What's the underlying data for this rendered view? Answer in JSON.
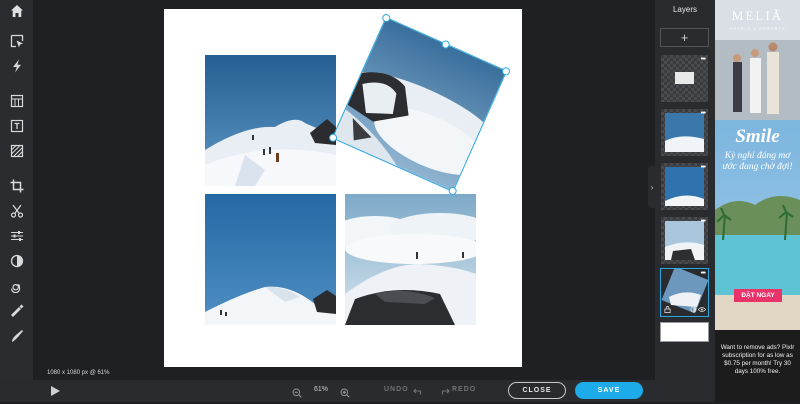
{
  "sidebar": {
    "tools": [
      {
        "name": "home-icon"
      },
      {
        "name": "select-icon"
      },
      {
        "name": "quick-fix-icon"
      },
      {
        "name": "layout-icon"
      },
      {
        "name": "text-icon"
      },
      {
        "name": "texture-icon"
      },
      {
        "name": "crop-icon"
      },
      {
        "name": "cut-icon"
      },
      {
        "name": "adjust-icon"
      },
      {
        "name": "filter-icon"
      },
      {
        "name": "liquify-icon"
      },
      {
        "name": "retouch-icon"
      },
      {
        "name": "draw-icon"
      }
    ],
    "settings_icon": "gear-icon"
  },
  "canvas": {
    "info": "1080 x 1080 px @ 61%",
    "background": "#ffffff"
  },
  "bottom_bar": {
    "zoom_value": "61%",
    "undo_label": "UNDO",
    "redo_label": "REDO",
    "close_label": "CLOSE",
    "save_label": "SAVE"
  },
  "layers_panel": {
    "title": "Layers",
    "add_label": "+",
    "more_label": "•••"
  },
  "ad": {
    "brand": "MELIÃ",
    "brand_sub": "HOTELS & RESORTS",
    "headline": "Smile",
    "body": "Kỳ nghỉ đáng mơ ước đang chờ đợi!",
    "cta": "ĐẶT NGAY",
    "remove_text": "Want to remove ads? Pixlr subscription for as low as $0.75 per month! Try 30 days 100% free."
  },
  "colors": {
    "accent": "#1eabe9",
    "selection": "#2ba7e0",
    "ad_cta": "#e8336b"
  }
}
